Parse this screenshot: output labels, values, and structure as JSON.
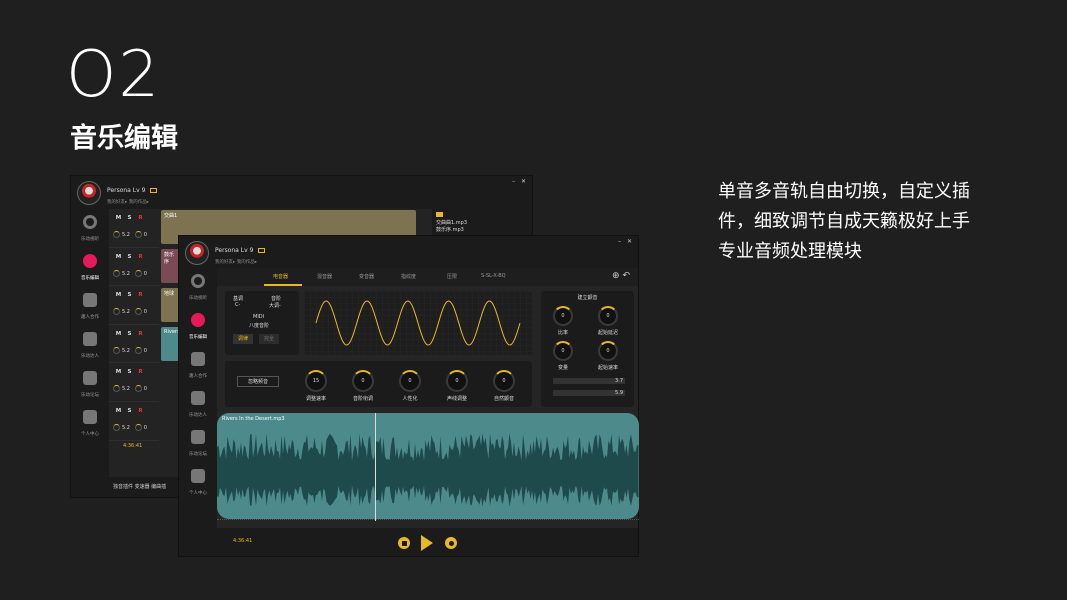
{
  "slide": {
    "number": "O2",
    "title": "音乐编辑",
    "description_lines": [
      "单音多音轨自由切换，自定义插",
      "件，细致调节自成天籁极好上手",
      "专业音频处理模块"
    ]
  },
  "colors": {
    "accent": "#e8b923",
    "active_nav": "#e6195a",
    "audio_lane": "#4d8a8c",
    "track1": "#7d7350",
    "track_pink": "#7a4a55"
  },
  "user": {
    "name": "Persona",
    "level": "Lv 9",
    "link_friends": "我的好友▸",
    "link_works": "我的作品▸"
  },
  "window_controls": "–  ✕",
  "sidebar": [
    {
      "label": "乐动视听",
      "icon": "headphones-icon"
    },
    {
      "label": "音乐编辑",
      "icon": "music-edit-icon"
    },
    {
      "label": "趣人合作",
      "icon": "handshake-icon"
    },
    {
      "label": "乐动达人",
      "icon": "star-user-icon"
    },
    {
      "label": "乐动论坛",
      "icon": "chat-icon"
    },
    {
      "label": "个人中心",
      "icon": "profile-icon"
    }
  ],
  "back_window": {
    "tracks": [
      {
        "m": "M",
        "s": "S",
        "r": "R",
        "vol": "5.2",
        "pan": "0",
        "lane": "交曲1"
      },
      {
        "m": "M",
        "s": "S",
        "r": "R",
        "vol": "5.2",
        "pan": "0",
        "lane": "鼓乐序"
      },
      {
        "m": "M",
        "s": "S",
        "r": "R",
        "vol": "5.2",
        "pan": "0",
        "lane": "地球"
      },
      {
        "m": "M",
        "s": "S",
        "r": "R",
        "vol": "5.2",
        "pan": "0",
        "lane": "Rivers"
      },
      {
        "m": "M",
        "s": "S",
        "r": "R",
        "vol": "5.2",
        "pan": "0",
        "lane": ""
      },
      {
        "m": "M",
        "s": "S",
        "r": "R",
        "vol": "5.2",
        "pan": "0",
        "lane": ""
      }
    ],
    "files": [
      "交曲曲1.mp3",
      "鼓乐序.mp3"
    ],
    "time": "4:36:41",
    "bottom_buttons": "独音插件  变速器  编曲插"
  },
  "front_window": {
    "tabs": [
      "电音器",
      "混音器",
      "变音器",
      "指纹度",
      "压限",
      "S-SL-X-BQ"
    ],
    "pitch": {
      "base_label": "基调",
      "base_value": "C-",
      "mode_label": "音阶",
      "mode_value": "大调-",
      "midi": "MIDI",
      "octave": "八度音阶",
      "btn_on": "调律",
      "btn_off": "完全"
    },
    "reset_label": "忽略频音",
    "knobs": [
      {
        "label": "调整速率",
        "value": "15"
      },
      {
        "label": "音阶衔调",
        "value": "0"
      },
      {
        "label": "人性化",
        "value": "0"
      },
      {
        "label": "声线调整",
        "value": "0"
      },
      {
        "label": "自然颤音",
        "value": "0"
      }
    ],
    "right_panel": {
      "title": "建立颤音",
      "knobs": [
        {
          "label": "比率",
          "value": "0"
        },
        {
          "label": "起始延迟",
          "value": "0"
        },
        {
          "label": "变量",
          "value": "0"
        },
        {
          "label": "起始速率",
          "value": "0"
        }
      ],
      "slider1": "3.7",
      "slider2": "5.9"
    },
    "audio_file": "Rivers In the Desert.mp3",
    "time": "4:36:41"
  }
}
